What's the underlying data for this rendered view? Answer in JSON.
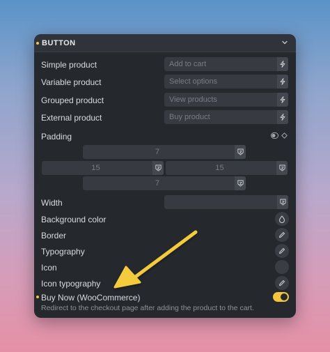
{
  "header": {
    "title": "BUTTON"
  },
  "fields": [
    {
      "label": "Simple product",
      "placeholder": "Add to cart"
    },
    {
      "label": "Variable product",
      "placeholder": "Select options"
    },
    {
      "label": "Grouped product",
      "placeholder": "View products"
    },
    {
      "label": "External product",
      "placeholder": "Buy product"
    }
  ],
  "padding": {
    "label": "Padding",
    "top": "7",
    "left": "15",
    "right": "15",
    "bottom": "7"
  },
  "width": {
    "label": "Width",
    "value": ""
  },
  "rows": {
    "background_color": "Background color",
    "border": "Border",
    "typography": "Typography",
    "icon": "Icon",
    "icon_typography": "Icon typography"
  },
  "buy_now": {
    "label": "Buy Now (WooCommerce)",
    "description": "Redirect to the checkout page after adding the product to the cart.",
    "enabled": true
  },
  "colors": {
    "accent": "#f2c53d",
    "panel": "#25282d",
    "field": "#373a41"
  }
}
